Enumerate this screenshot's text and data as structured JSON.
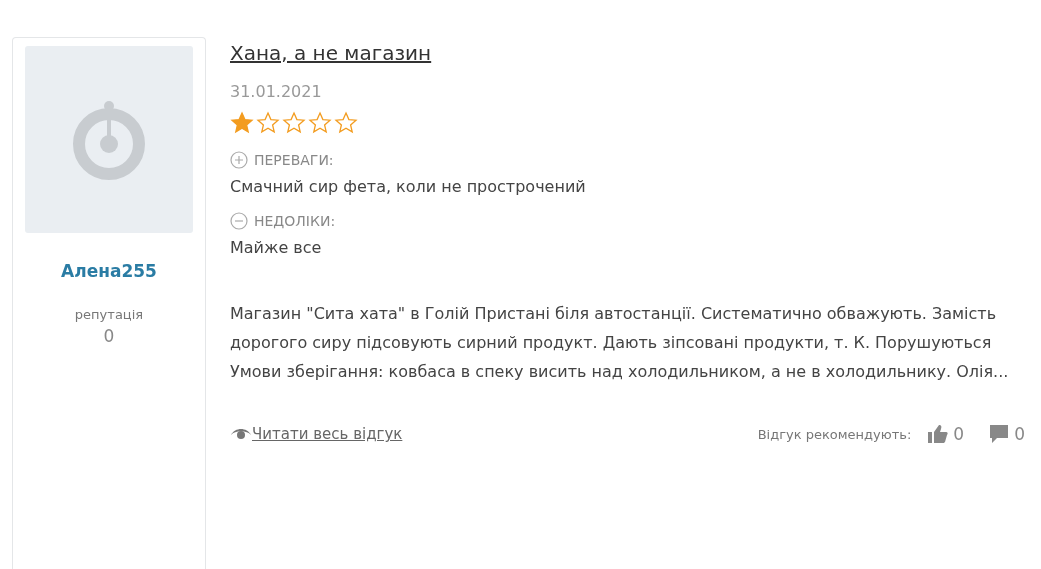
{
  "author": {
    "name": "Алена255",
    "reputation_label": "репутація",
    "reputation": "0"
  },
  "review": {
    "title": "Хана, а не магазин",
    "date": "31.01.2021",
    "stars": 1,
    "pros_label": "ПЕРЕВАГИ:",
    "pros": "Смачний сир фета, коли не прострочений",
    "cons_label": "НЕДОЛІКИ:",
    "cons": "Майже все",
    "body": "Магазин \"Сита хата\" в Голій Пристані біля автостанції. Систематично обважують. Замість дорогого сиру підсовують сирний продукт. Дають зіпсовані продукти, т. К. Порушуються Умови зберігання: ковбаса в спеку висить над холодильником, а не в холодильнику. Олія...",
    "read_more": "Читати весь відгук",
    "recommend_label": "Відгук рекомендують:",
    "likes": "0",
    "comments": "0"
  }
}
